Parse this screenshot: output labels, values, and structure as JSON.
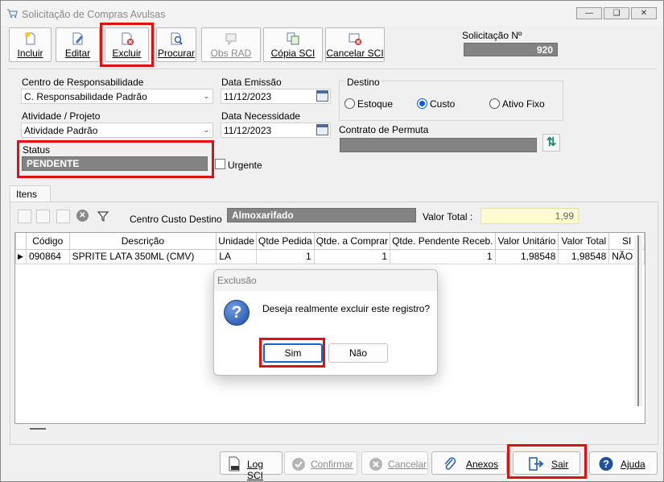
{
  "window": {
    "title": "Solicitação de Compras Avulsas"
  },
  "toolbar": {
    "incluir": "Incluir",
    "editar": "Editar",
    "excluir": "Excluir",
    "procurar": "Procurar",
    "obs_rad": "Obs RAD",
    "copia_sci": "Cópia SCI",
    "cancelar_sci": "Cancelar SCI"
  },
  "solicitacao": {
    "label": "Solicitação Nº",
    "value": "920"
  },
  "form": {
    "centro_resp_label": "Centro de Responsabilidade",
    "centro_resp_value": "C. Responsabilidade Padrão",
    "data_emissao_label": "Data Emissão",
    "data_emissao_value": "11/12/2023",
    "destino_label": "Destino",
    "destino_options": [
      "Estoque",
      "Custo",
      "Ativo Fixo"
    ],
    "destino_selected": "Custo",
    "atividade_label": "Atividade / Projeto",
    "atividade_value": "Atividade Padrão",
    "data_necessidade_label": "Data Necessidade",
    "data_necessidade_value": "11/12/2023",
    "contrato_label": "Contrato de Permuta",
    "contrato_value": "",
    "status_label": "Status",
    "status_value": "PENDENTE",
    "urgente_label": "Urgente"
  },
  "items_tab": {
    "tab_label": "Itens",
    "centro_custo_label": "Centro Custo Destino",
    "centro_custo_value": "Almoxarifado",
    "valor_total_label": "Valor Total :",
    "valor_total_value": "1,99"
  },
  "grid": {
    "columns": [
      "Código",
      "Descrição",
      "Unidade",
      "Qtde Pedida",
      "Qtde. a Comprar",
      "Qtde. Pendente Receb.",
      "Valor Unitário",
      "Valor Total",
      "SI"
    ],
    "rows": [
      [
        "090864",
        "SPRITE LATA 350ML (CMV)",
        "LA",
        "1",
        "1",
        "1",
        "1,98548",
        "1,98548",
        "NÃO A"
      ]
    ]
  },
  "bottom": {
    "log_sci": "Log SCI",
    "confirmar": "Confirmar",
    "cancelar": "Cancelar",
    "anexos": "Anexos",
    "sair": "Sair",
    "ajuda": "Ajuda"
  },
  "dialog": {
    "title": "Exclusão",
    "message": "Deseja realmente excluir este registro?",
    "yes": "Sim",
    "no": "Não"
  },
  "colors": {
    "highlight": "#e01010",
    "accent": "#0a5fd8",
    "status_bg": "#838383",
    "total_bg": "#fdfbd2"
  }
}
